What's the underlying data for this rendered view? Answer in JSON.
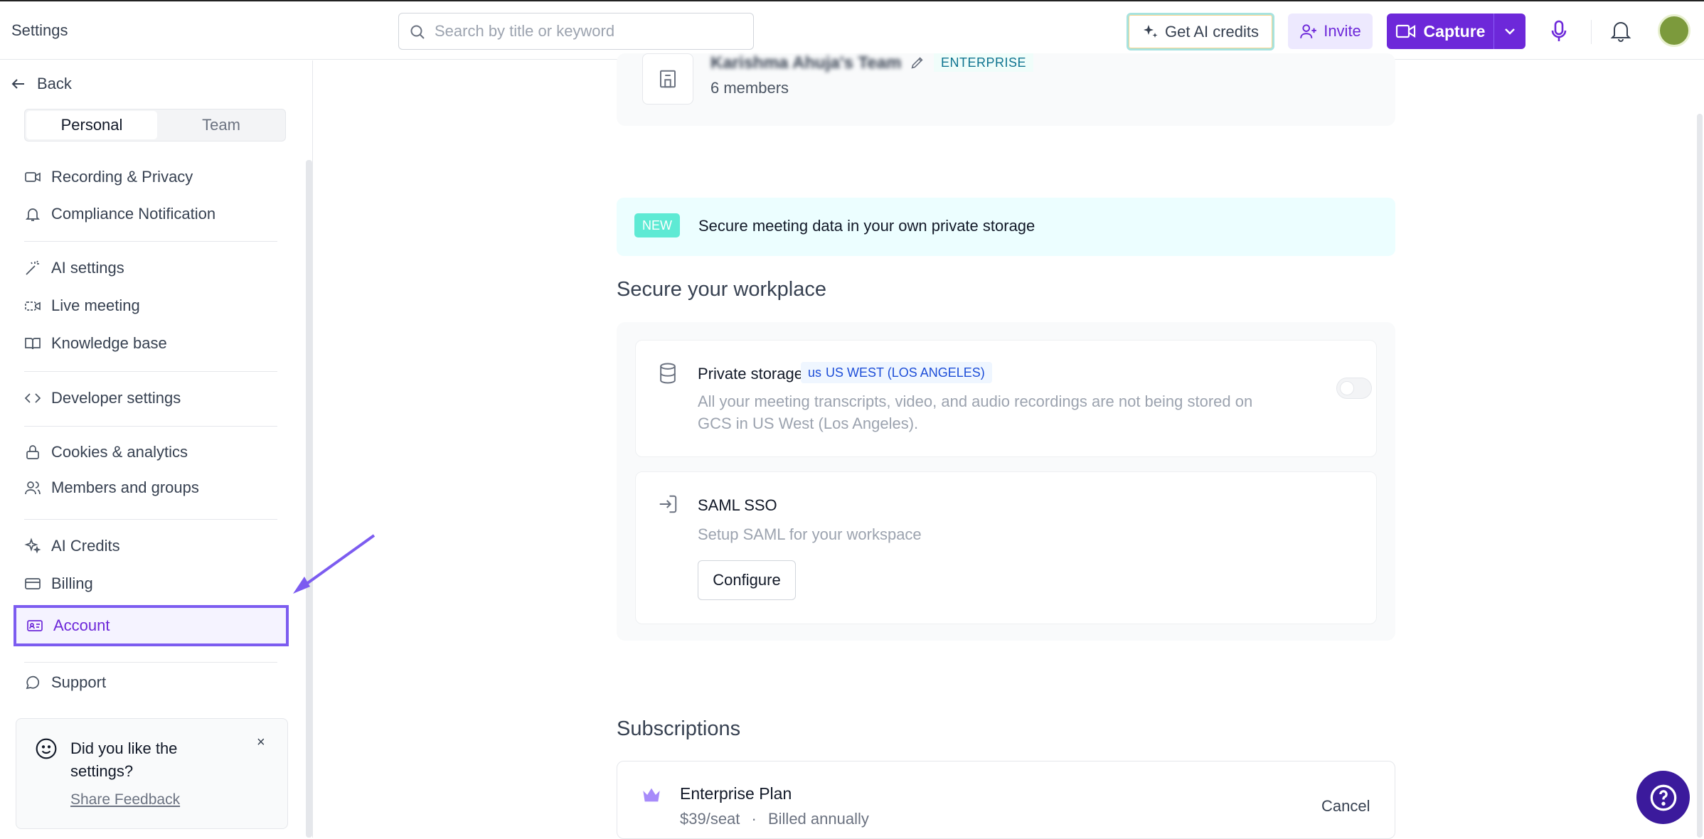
{
  "header": {
    "title": "Settings",
    "search_placeholder": "Search by title or keyword",
    "get_credits_label": "Get AI credits",
    "invite_label": "Invite",
    "capture_label": "Capture"
  },
  "sidebar": {
    "back_label": "Back",
    "tabs": {
      "personal": "Personal",
      "team": "Team"
    },
    "items": [
      {
        "label": "Recording & Privacy",
        "icon": "video-icon"
      },
      {
        "label": "Compliance Notification",
        "icon": "bell-icon"
      },
      {
        "label": "AI settings",
        "icon": "magic-wand-icon"
      },
      {
        "label": "Live meeting",
        "icon": "live-video-icon"
      },
      {
        "label": "Knowledge base",
        "icon": "book-icon"
      },
      {
        "label": "Developer settings",
        "icon": "code-icon"
      },
      {
        "label": "Cookies & analytics",
        "icon": "lock-icon"
      },
      {
        "label": "Members and groups",
        "icon": "users-icon"
      },
      {
        "label": "AI Credits",
        "icon": "sparkle-icon"
      },
      {
        "label": "Billing",
        "icon": "credit-card-icon"
      },
      {
        "label": "Account",
        "icon": "id-card-icon"
      },
      {
        "label": "Support",
        "icon": "chat-bubble-icon"
      }
    ],
    "feedback": {
      "question": "Did you like the settings?",
      "link": "Share Feedback",
      "close": "×"
    }
  },
  "main": {
    "team": {
      "name": "Karishma Ahuja's Team",
      "badge": "ENTERPRISE",
      "members": "6 members"
    },
    "banner": {
      "badge": "NEW",
      "text": "Secure meeting data in your own private storage"
    },
    "secure_heading": "Secure your workplace",
    "private_storage": {
      "title": "Private storage",
      "region_code": "us",
      "region": "US WEST (LOS ANGELES)",
      "desc_line1": "All your meeting transcripts, video, and audio recordings are not being stored on",
      "desc_line2": "GCS in US West (Los Angeles).",
      "enabled": false
    },
    "saml": {
      "title": "SAML SSO",
      "desc": "Setup SAML for your workspace",
      "button": "Configure"
    },
    "subscriptions_heading": "Subscriptions",
    "plan": {
      "name": "Enterprise Plan",
      "price": "$39/seat",
      "separator": "·",
      "billing": "Billed annually",
      "cancel": "Cancel"
    }
  },
  "colors": {
    "accent": "#6d28d9",
    "highlight_border": "#7c5cf0",
    "banner_bg": "#ecfeff"
  }
}
